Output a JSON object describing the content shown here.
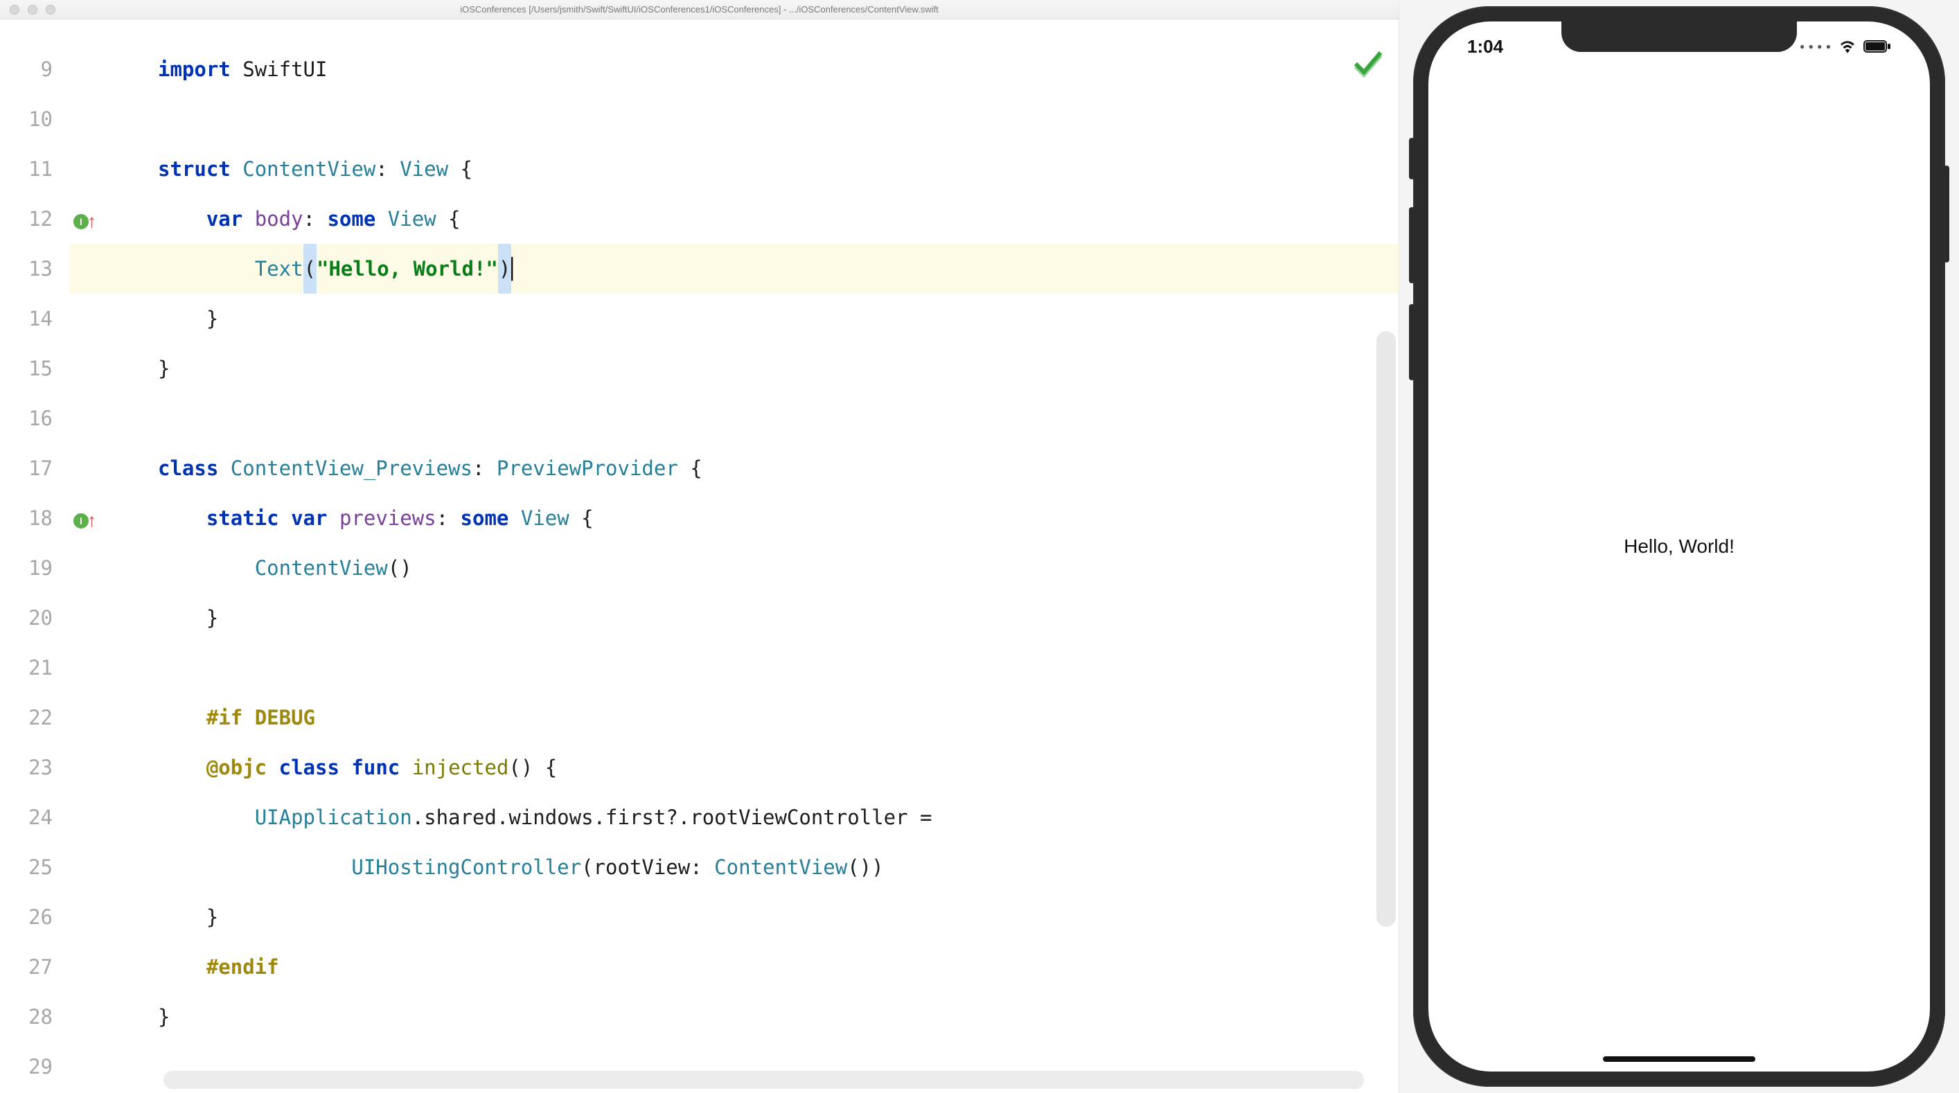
{
  "window": {
    "title": "iOSConferences [/Users/jsmith/Swift/SwiftUI/iOSConferences1/iOSConferences] - .../iOSConferences/ContentView.swift"
  },
  "editor": {
    "first_line_no": 9,
    "lines": [
      {
        "no": "9",
        "tokens": [
          [
            "kw",
            "import"
          ],
          [
            "plain",
            " "
          ],
          [
            "plain",
            "SwiftUI"
          ]
        ]
      },
      {
        "no": "10",
        "tokens": []
      },
      {
        "no": "11",
        "tokens": [
          [
            "kw",
            "struct"
          ],
          [
            "plain",
            " "
          ],
          [
            "tn",
            "ContentView"
          ],
          [
            "plain",
            ": "
          ],
          [
            "tn",
            "View"
          ],
          [
            "plain",
            " {"
          ]
        ]
      },
      {
        "no": "12",
        "mark": true,
        "tokens": [
          [
            "plain",
            "    "
          ],
          [
            "kw",
            "var"
          ],
          [
            "plain",
            " "
          ],
          [
            "id",
            "body"
          ],
          [
            "plain",
            ": "
          ],
          [
            "kw",
            "some"
          ],
          [
            "plain",
            " "
          ],
          [
            "tn",
            "View"
          ],
          [
            "plain",
            " {"
          ]
        ]
      },
      {
        "no": "13",
        "highlight": true,
        "tokens": [
          [
            "plain",
            "        "
          ],
          [
            "fn-call",
            "Text"
          ],
          [
            "match-br",
            "("
          ],
          [
            "str",
            "\"Hello, World!\""
          ],
          [
            "match-br",
            ")"
          ],
          [
            "cursor-ptr",
            "▏"
          ]
        ]
      },
      {
        "no": "14",
        "tokens": [
          [
            "plain",
            "    }"
          ]
        ]
      },
      {
        "no": "15",
        "tokens": [
          [
            "plain",
            "}"
          ]
        ]
      },
      {
        "no": "16",
        "tokens": []
      },
      {
        "no": "17",
        "tokens": [
          [
            "kw",
            "class"
          ],
          [
            "plain",
            " "
          ],
          [
            "tn",
            "ContentView_Previews"
          ],
          [
            "plain",
            ": "
          ],
          [
            "tn",
            "PreviewProvider"
          ],
          [
            "plain",
            " {"
          ]
        ]
      },
      {
        "no": "18",
        "mark": true,
        "tokens": [
          [
            "plain",
            "    "
          ],
          [
            "kw",
            "static"
          ],
          [
            "plain",
            " "
          ],
          [
            "kw",
            "var"
          ],
          [
            "plain",
            " "
          ],
          [
            "id",
            "previews"
          ],
          [
            "plain",
            ": "
          ],
          [
            "kw",
            "some"
          ],
          [
            "plain",
            " "
          ],
          [
            "tn",
            "View"
          ],
          [
            "plain",
            " {"
          ]
        ]
      },
      {
        "no": "19",
        "tokens": [
          [
            "plain",
            "        "
          ],
          [
            "fn-call",
            "ContentView"
          ],
          [
            "plain",
            "()"
          ]
        ]
      },
      {
        "no": "20",
        "tokens": [
          [
            "plain",
            "    }"
          ]
        ]
      },
      {
        "no": "21",
        "tokens": []
      },
      {
        "no": "22",
        "tokens": [
          [
            "plain",
            "    "
          ],
          [
            "dir",
            "#if"
          ],
          [
            "plain",
            " "
          ],
          [
            "dir",
            "DEBUG"
          ]
        ]
      },
      {
        "no": "23",
        "tokens": [
          [
            "plain",
            "    "
          ],
          [
            "ann",
            "@objc"
          ],
          [
            "plain",
            " "
          ],
          [
            "kw",
            "class"
          ],
          [
            "plain",
            " "
          ],
          [
            "kw",
            "func"
          ],
          [
            "plain",
            " "
          ],
          [
            "fn",
            "injected"
          ],
          [
            "plain",
            "() {"
          ]
        ]
      },
      {
        "no": "24",
        "tokens": [
          [
            "plain",
            "        "
          ],
          [
            "fn-call",
            "UIApplication"
          ],
          [
            "plain",
            ".shared.windows.first?.rootViewController ="
          ]
        ]
      },
      {
        "no": "25",
        "tokens": [
          [
            "plain",
            "                "
          ],
          [
            "fn-call",
            "UIHostingController"
          ],
          [
            "plain",
            "(rootView: "
          ],
          [
            "fn-call",
            "ContentView"
          ],
          [
            "plain",
            "())"
          ]
        ]
      },
      {
        "no": "26",
        "tokens": [
          [
            "plain",
            "    }"
          ]
        ]
      },
      {
        "no": "27",
        "tokens": [
          [
            "plain",
            "    "
          ],
          [
            "dir",
            "#endif"
          ]
        ]
      },
      {
        "no": "28",
        "tokens": [
          [
            "plain",
            "}"
          ]
        ]
      },
      {
        "no": "29",
        "tokens": []
      }
    ]
  },
  "simulator": {
    "time": "1:04",
    "content_text": "Hello, World!"
  }
}
